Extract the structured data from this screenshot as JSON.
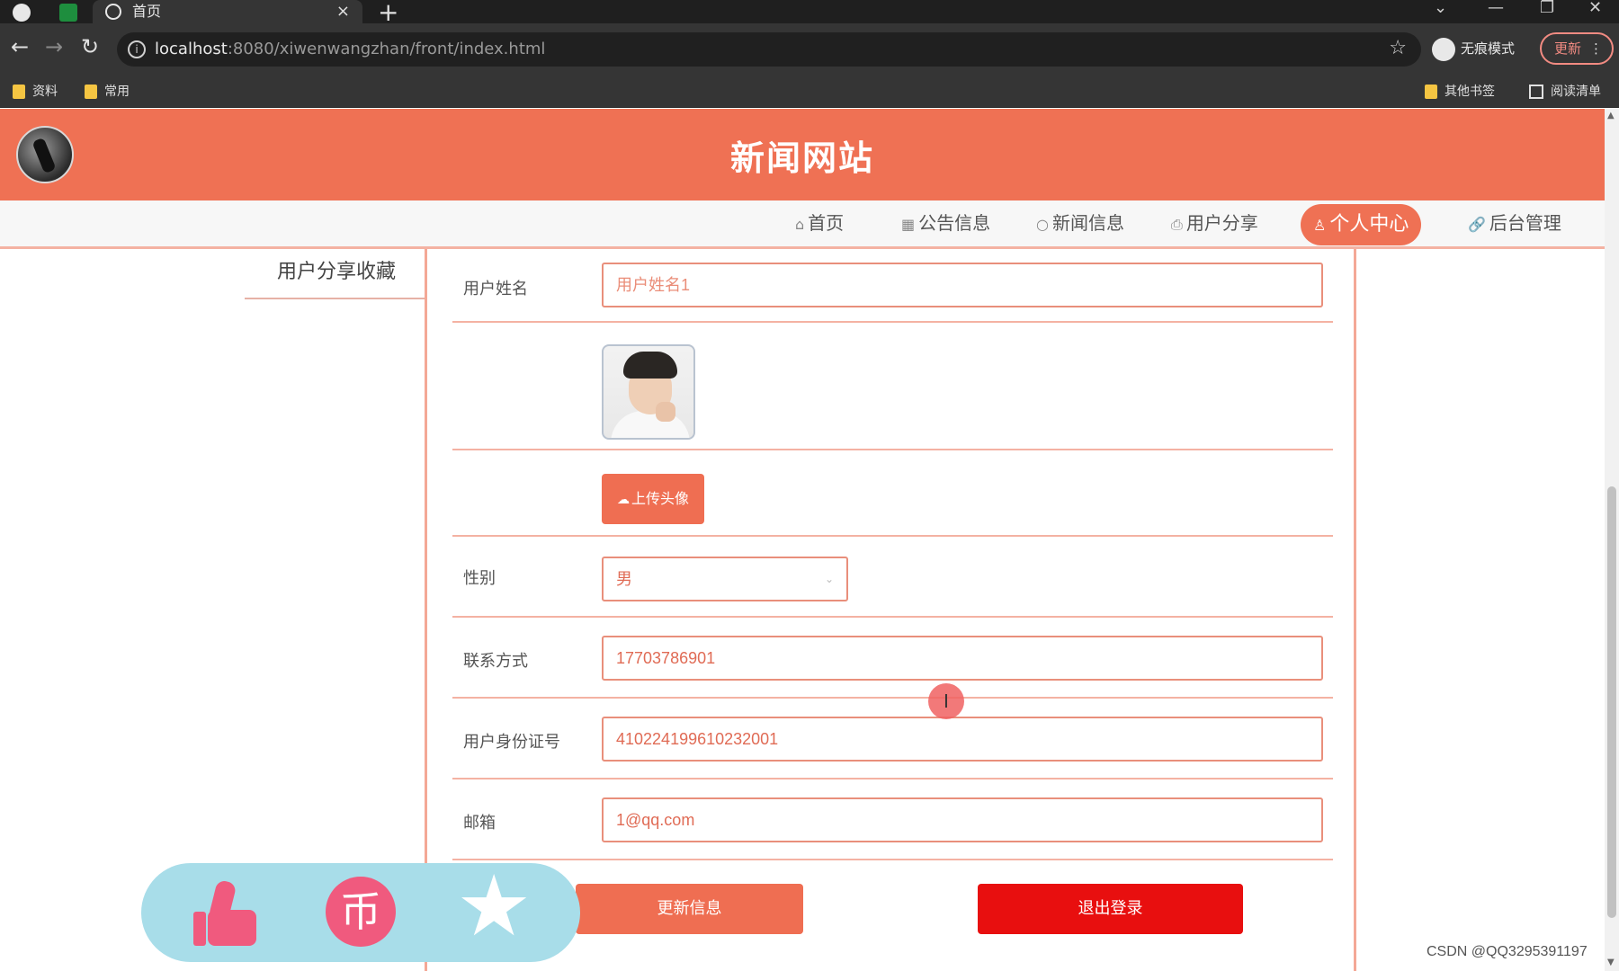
{
  "browser": {
    "tab_title": "首页",
    "tab_close": "×",
    "new_tab": "+",
    "url_host": "localhost",
    "url_rest": ":8080/xiwenwangzhan/front/index.html",
    "incognito_label": "无痕模式",
    "update_label": "更新",
    "bookmarks": [
      "资料",
      "常用"
    ],
    "other_bookmarks": "其他书签",
    "reading_list": "阅读清单"
  },
  "site": {
    "title": "新闻网站",
    "nav": [
      {
        "icon": "⌂",
        "label": "首页"
      },
      {
        "icon": "▦",
        "label": "公告信息"
      },
      {
        "icon": "○",
        "label": "新闻信息"
      },
      {
        "icon": "⎙",
        "label": "用户分享"
      },
      {
        "icon": "♙",
        "label": "个人中心"
      },
      {
        "icon": "🔗",
        "label": "后台管理"
      }
    ],
    "active_nav": "个人中心"
  },
  "sidebar": {
    "items": [
      "用户分享收藏"
    ]
  },
  "form": {
    "name_label": "用户姓名",
    "name_placeholder": "用户姓名1",
    "upload_label": "上传头像",
    "gender_label": "性别",
    "gender_value": "男",
    "phone_label": "联系方式",
    "phone_value": "17703786901",
    "id_label": "用户身份证号",
    "id_value": "410224199610232001",
    "email_label": "邮箱",
    "email_value": "1@qq.com",
    "update_button": "更新信息",
    "logout_button": "退出登录"
  },
  "cursor_glyph": "I",
  "float_bar": {
    "coin_glyph": "币",
    "star_glyph": "★"
  },
  "watermark": "CSDN @QQ3295391197",
  "colors": {
    "brand": "#ef7154",
    "danger": "#e80f0f",
    "float_bar_bg": "#a8dde9",
    "float_icon": "#f05a7e"
  }
}
